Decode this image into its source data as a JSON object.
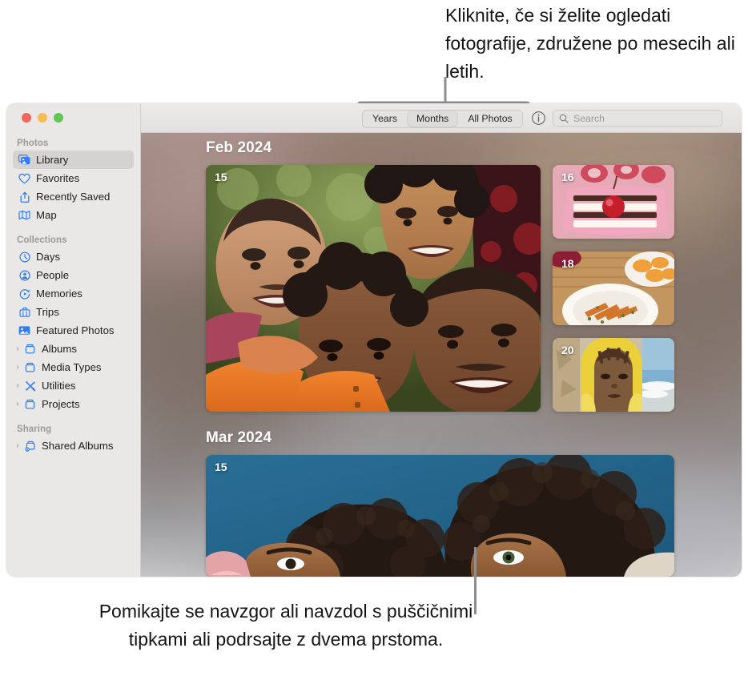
{
  "callouts": {
    "top": "Kliknite, če si želite ogledati fotografije, združene po mesecih ali letih.",
    "bottom": "Pomikajte se navzgor ali navzdol s puščičnimi tipkami ali podrsajte z dvema prstoma."
  },
  "window": {
    "traffic_lights": [
      "close",
      "minimize",
      "zoom"
    ]
  },
  "toolbar": {
    "segments": [
      {
        "label": "Years",
        "selected": false
      },
      {
        "label": "Months",
        "selected": true
      },
      {
        "label": "All Photos",
        "selected": false
      }
    ],
    "info_icon": "info-circle-icon",
    "search": {
      "icon": "search-icon",
      "placeholder": "Search",
      "value": ""
    }
  },
  "sidebar": {
    "sections": [
      {
        "title": "Photos",
        "items": [
          {
            "label": "Library",
            "icon": "library-icon",
            "selected": true,
            "disclosure": false
          },
          {
            "label": "Favorites",
            "icon": "heart-icon",
            "selected": false,
            "disclosure": false
          },
          {
            "label": "Recently Saved",
            "icon": "recently-saved-icon",
            "selected": false,
            "disclosure": false
          },
          {
            "label": "Map",
            "icon": "map-icon",
            "selected": false,
            "disclosure": false
          }
        ]
      },
      {
        "title": "Collections",
        "items": [
          {
            "label": "Days",
            "icon": "clock-icon",
            "selected": false,
            "disclosure": false
          },
          {
            "label": "People",
            "icon": "person-circle-icon",
            "selected": false,
            "disclosure": false
          },
          {
            "label": "Memories",
            "icon": "memories-icon",
            "selected": false,
            "disclosure": false
          },
          {
            "label": "Trips",
            "icon": "suitcase-icon",
            "selected": false,
            "disclosure": false
          },
          {
            "label": "Featured Photos",
            "icon": "photo-icon",
            "selected": false,
            "disclosure": false
          },
          {
            "label": "Albums",
            "icon": "album-icon",
            "selected": false,
            "disclosure": true
          },
          {
            "label": "Media Types",
            "icon": "album-icon",
            "selected": false,
            "disclosure": true
          },
          {
            "label": "Utilities",
            "icon": "utilities-icon",
            "selected": false,
            "disclosure": true
          },
          {
            "label": "Projects",
            "icon": "album-icon",
            "selected": false,
            "disclosure": true
          }
        ]
      },
      {
        "title": "Sharing",
        "items": [
          {
            "label": "Shared Albums",
            "icon": "shared-album-icon",
            "selected": false,
            "disclosure": true
          }
        ]
      }
    ]
  },
  "library": {
    "months": [
      {
        "header": "Feb 2024",
        "hero": {
          "day": "15",
          "description": "group-selfie-four-people-outdoors"
        },
        "thumbnails": [
          {
            "day": "16",
            "description": "pink-layer-cake-with-cherry"
          },
          {
            "day": "18",
            "description": "plated-roasted-carrots-and-oranges"
          },
          {
            "day": "20",
            "description": "person-in-yellow-hood-at-beach"
          }
        ]
      },
      {
        "header": "Mar 2024",
        "hero": {
          "day": "15",
          "description": "two-people-lying-down-blue-backdrop"
        },
        "thumbnails": []
      }
    ]
  },
  "colors": {
    "accent": "#2f7cf6",
    "selected_row": "#d5d3d2",
    "sidebar_bg": "#e9e8e7",
    "toolbar_bg": "#e8e6e5",
    "callout_text": "#141414",
    "leader_line": "#8e8e8e"
  }
}
